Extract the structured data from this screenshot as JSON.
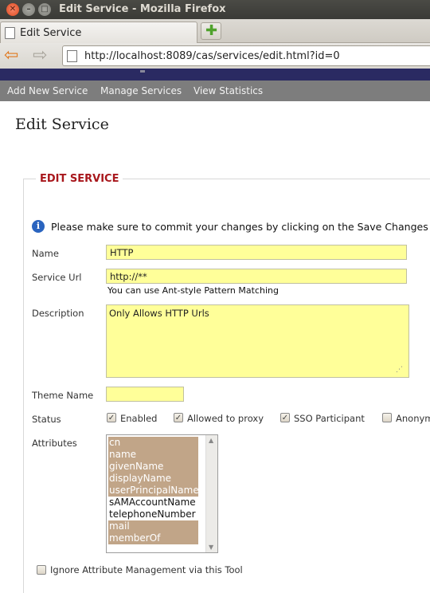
{
  "window": {
    "title": "Edit Service - Mozilla Firefox"
  },
  "tabs": [
    {
      "label": "Edit Service"
    }
  ],
  "navbar": {
    "url": "http://localhost:8089/cas/services/edit.html?id=0"
  },
  "menu": {
    "items": [
      "Add New Service",
      "Manage Services",
      "View Statistics"
    ]
  },
  "page": {
    "title": "Edit Service"
  },
  "form": {
    "legend": "EDIT SERVICE",
    "info": "Please make sure to commit your changes by clicking on the Save Changes butt",
    "name": {
      "label": "Name",
      "value": "HTTP"
    },
    "service_url": {
      "label": "Service Url",
      "value": "http://**",
      "hint": "You can use Ant-style Pattern Matching"
    },
    "description": {
      "label": "Description",
      "value": "Only Allows HTTP Urls"
    },
    "theme_name": {
      "label": "Theme Name",
      "value": ""
    },
    "status": {
      "label": "Status",
      "options": [
        {
          "label": "Enabled",
          "checked": true
        },
        {
          "label": "Allowed to proxy",
          "checked": true
        },
        {
          "label": "SSO Participant",
          "checked": true
        },
        {
          "label": "Anonym",
          "checked": false
        }
      ]
    },
    "attributes": {
      "label": "Attributes",
      "options": [
        {
          "label": "cn",
          "selected": true
        },
        {
          "label": "name",
          "selected": true
        },
        {
          "label": "givenName",
          "selected": true
        },
        {
          "label": "displayName",
          "selected": true
        },
        {
          "label": "userPrincipalName",
          "selected": true
        },
        {
          "label": "sAMAccountName",
          "selected": false
        },
        {
          "label": "telephoneNumber",
          "selected": false
        },
        {
          "label": "mail",
          "selected": true
        },
        {
          "label": "memberOf",
          "selected": true
        }
      ]
    },
    "ignore_attribute_management": {
      "label": "Ignore Attribute Management via this Tool",
      "checked": false
    }
  },
  "colors": {
    "legend": "#a8171c",
    "input_bg": "#ffff99",
    "selection": "#c1a588",
    "menu_bg": "#7d7d7d",
    "header_band": "#2a2a62"
  }
}
